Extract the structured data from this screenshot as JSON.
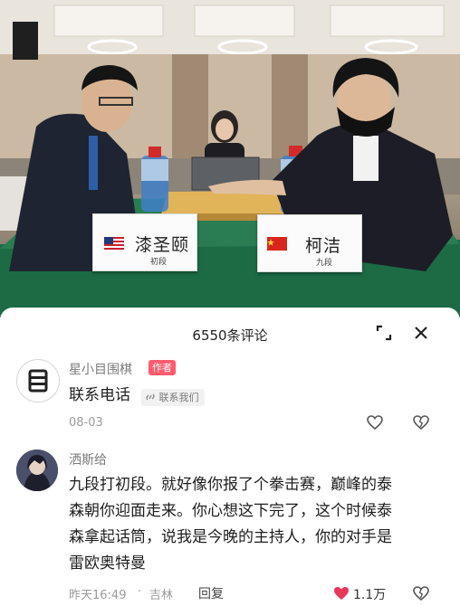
{
  "photo": {
    "left_player": {
      "name": "漆圣颐",
      "rank": "初段",
      "flag": "us-flag-icon"
    },
    "right_player": {
      "name": "柯洁",
      "rank": "九段",
      "flag": "cn-flag-icon"
    }
  },
  "comments_panel": {
    "title": "6550条评论",
    "expand_icon": "expand-icon",
    "close_icon": "close-icon"
  },
  "comments": [
    {
      "author": "星小目围棋",
      "badge": "作者",
      "text": "联系电话",
      "contact_label": "联系我们",
      "date": "08-03"
    },
    {
      "author": "洒斯给",
      "text_lines": [
        "九段打初段。就好像你报了个拳击赛，巅峰的泰",
        "森朝你迎面走来。你心想这下完了，这个时候泰",
        "森拿起话筒，说我是今晚的主持人，你的对手是",
        "雷欧奥特曼"
      ],
      "time": "昨天16:49",
      "location": "吉林",
      "reply_label": "回复",
      "like_count": "1.1万"
    }
  ],
  "colors": {
    "author_badge": "#ff5a6e",
    "liked_heart": "#e8365a",
    "text_gray": "#9a9a9a"
  }
}
